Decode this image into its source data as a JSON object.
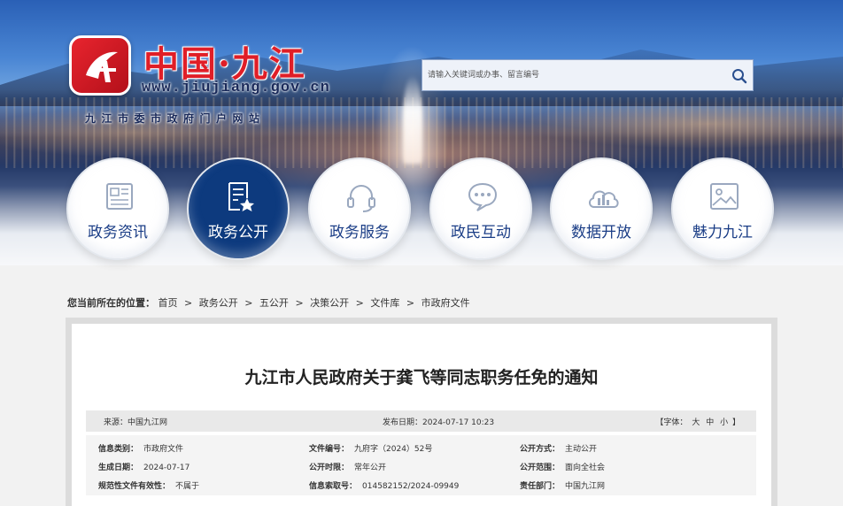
{
  "header": {
    "logo_title": "中国·九江",
    "logo_url": "www.jiujiang.gov.cn",
    "logo_subtitle": "九江市委市政府门户网站",
    "search_placeholder": "请输入关键词或办事、留言编号"
  },
  "nav": [
    {
      "label": "政务资讯",
      "icon": "newspaper-icon",
      "active": false
    },
    {
      "label": "政务公开",
      "icon": "document-star-icon",
      "active": true
    },
    {
      "label": "政务服务",
      "icon": "headset-icon",
      "active": false
    },
    {
      "label": "政民互动",
      "icon": "chat-bubble-icon",
      "active": false
    },
    {
      "label": "数据开放",
      "icon": "cloud-chart-icon",
      "active": false
    },
    {
      "label": "魅力九江",
      "icon": "image-icon",
      "active": false
    }
  ],
  "breadcrumb": {
    "label": "您当前所在的位置：",
    "items": [
      "首页",
      "政务公开",
      "五公开",
      "决策公开",
      "文件库",
      "市政府文件"
    ],
    "separator": ">"
  },
  "article": {
    "title": "九江市人民政府关于龚飞等同志职务任免的通知",
    "source_label": "来源：",
    "source_value": "中国九江网",
    "pub_label": "发布日期：",
    "pub_value": "2024-07-17 10:23",
    "fontsize_prefix": "【字体：",
    "fontsize_options": [
      "大",
      "中",
      "小"
    ],
    "fontsize_suffix": "】"
  },
  "meta": {
    "info_type_k": "信息类别：",
    "info_type_v": "市政府文件",
    "doc_no_k": "文件编号：",
    "doc_no_v": "九府字（2024）52号",
    "open_way_k": "公开方式：",
    "open_way_v": "主动公开",
    "gen_date_k": "生成日期：",
    "gen_date_v": "2024-07-17",
    "open_time_k": "公开时限：",
    "open_time_v": "常年公开",
    "open_scope_k": "公开范围：",
    "open_scope_v": "面向全社会",
    "validity_k": "规范性文件有效性：",
    "validity_v": "不属于",
    "index_k": "信息索取号：",
    "index_v": "014582152/2024-09949",
    "dept_k": "责任部门：",
    "dept_v": "中国九江网"
  }
}
